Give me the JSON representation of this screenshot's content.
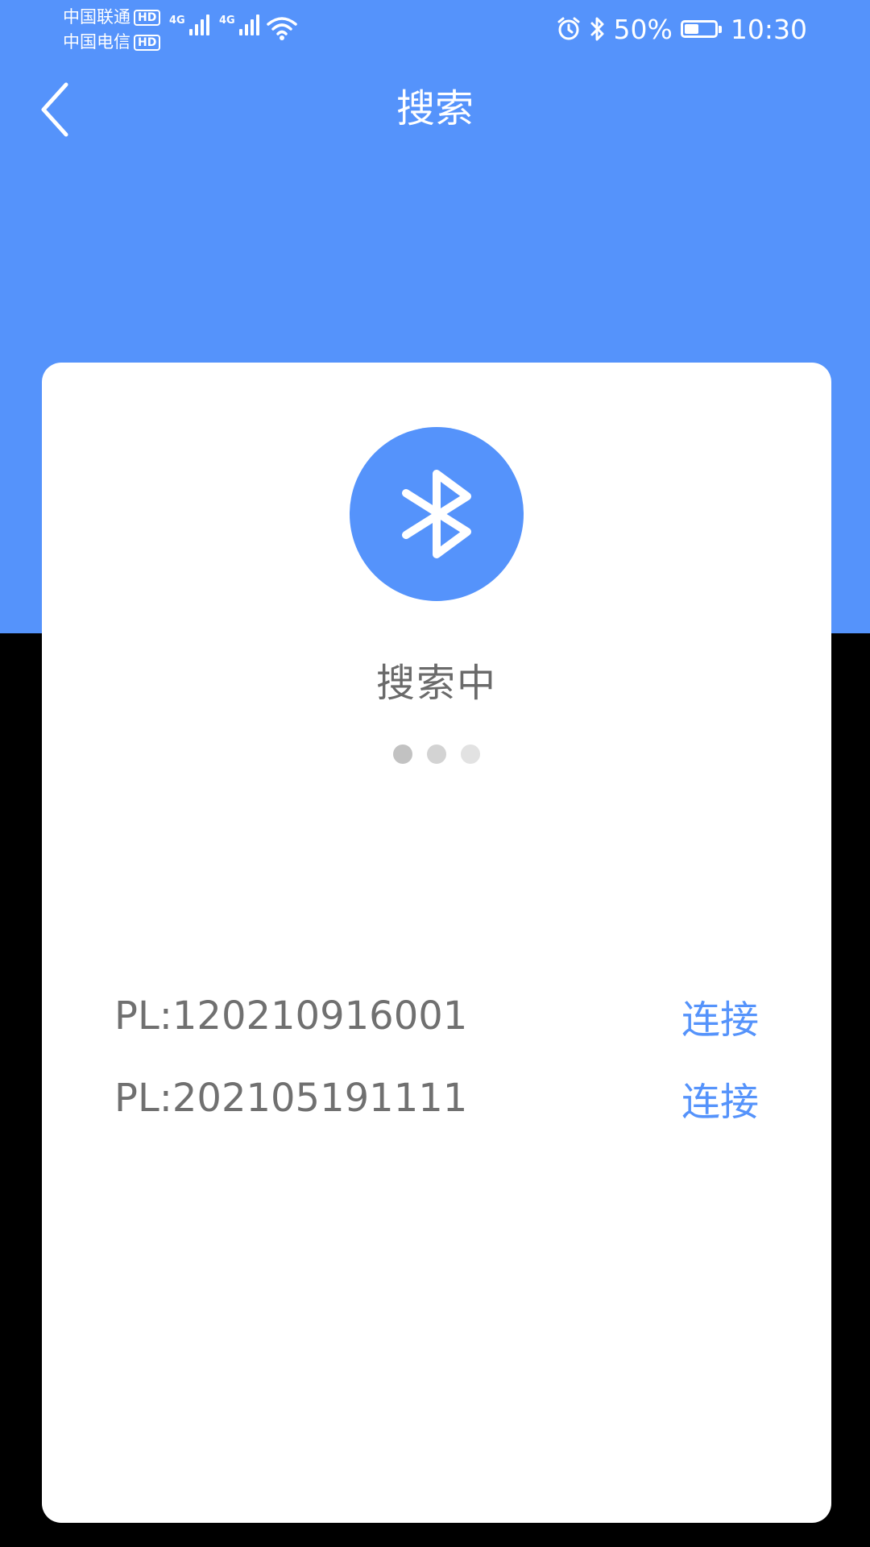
{
  "status_bar": {
    "carrier_1": "中国联通",
    "carrier_2": "中国电信",
    "hd_badge": "HD",
    "network_1": "4G",
    "network_2": "4G",
    "battery_percent": "50%",
    "battery_level": 0.5,
    "time": "10:30",
    "icons": [
      "alarm-icon",
      "bluetooth-icon",
      "wifi-icon",
      "battery-icon"
    ]
  },
  "header": {
    "title": "搜索",
    "back_icon": "chevron-left-icon"
  },
  "search": {
    "icon": "bluetooth-icon",
    "status_text": "搜索中",
    "dot_colors": [
      "#C2C2C2",
      "#D3D3D3",
      "#E2E2E2"
    ]
  },
  "devices": [
    {
      "name": "PL:120210916001",
      "action": "连接"
    },
    {
      "name": "PL:202105191111",
      "action": "连接"
    }
  ],
  "colors": {
    "accent": "#5593FB",
    "text_gray": "#707070",
    "background": "#000000",
    "card": "#FFFFFF"
  }
}
